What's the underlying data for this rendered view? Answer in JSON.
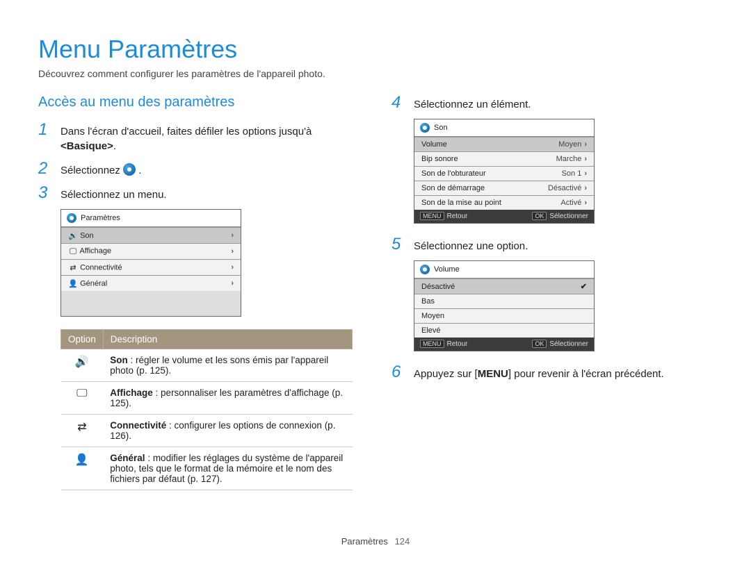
{
  "page": {
    "title": "Menu Paramètres",
    "subtitle": "Découvrez comment configurer les paramètres de l'appareil photo.",
    "section_heading": "Accès au menu des paramètres",
    "footer_label": "Paramètres",
    "footer_page": "124"
  },
  "steps": {
    "s1_num": "1",
    "s1_text_a": "Dans l'écran d'accueil, faites défiler les options jusqu'à ",
    "s1_text_b": "<Basique>",
    "s2_num": "2",
    "s2_text": "Sélectionnez ",
    "s3_num": "3",
    "s3_text": "Sélectionnez un menu.",
    "s4_num": "4",
    "s4_text": "Sélectionnez un élément.",
    "s5_num": "5",
    "s5_text": "Sélectionnez une option.",
    "s6_num": "6",
    "s6_text_a": "Appuyez sur [",
    "s6_text_b": "MENU",
    "s6_text_c": "] pour revenir à l'écran précédent."
  },
  "screenshot1": {
    "title": "Paramètres",
    "rows": [
      {
        "label": "Son"
      },
      {
        "label": "Affichage"
      },
      {
        "label": "Connectivité"
      },
      {
        "label": "Général"
      }
    ]
  },
  "screenshot2": {
    "title": "Son",
    "rows": [
      {
        "label": "Volume",
        "value": "Moyen"
      },
      {
        "label": "Bip sonore",
        "value": "Marche"
      },
      {
        "label": "Son de l'obturateur",
        "value": "Son 1"
      },
      {
        "label": "Son de démarrage",
        "value": "Désactivé"
      },
      {
        "label": "Son de la mise au point",
        "value": "Activé"
      }
    ],
    "footer": {
      "left_btn": "MENU",
      "left": "Retour",
      "right_btn": "OK",
      "right": "Sélectionner"
    }
  },
  "screenshot3": {
    "title": "Volume",
    "rows": [
      {
        "label": "Désactivé",
        "selected": true
      },
      {
        "label": "Bas"
      },
      {
        "label": "Moyen"
      },
      {
        "label": "Elevé"
      }
    ],
    "footer": {
      "left_btn": "MENU",
      "left": "Retour",
      "right_btn": "OK",
      "right": "Sélectionner"
    }
  },
  "option_table": {
    "head_option": "Option",
    "head_desc": "Description",
    "rows": [
      {
        "icon": "🔊",
        "title": "Son",
        "text": " : régler le volume et les sons émis par l'appareil photo (p. 125)."
      },
      {
        "icon": "🖵",
        "title": "Affichage",
        "text": " : personnaliser les paramètres d'affichage (p. 125)."
      },
      {
        "icon": "⇄",
        "title": "Connectivité",
        "text": " : configurer les options de connexion (p. 126)."
      },
      {
        "icon": "👤",
        "title": "Général",
        "text": " : modifier les réglages du système de l'appareil photo, tels que le format de la mémoire et le nom des fichiers par défaut (p. 127)."
      }
    ]
  }
}
